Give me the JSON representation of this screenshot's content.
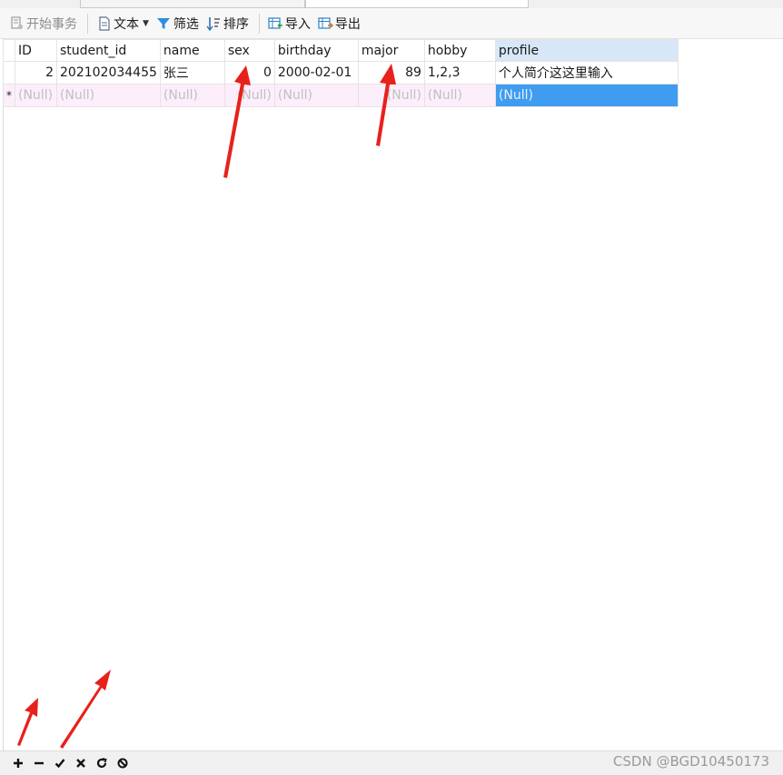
{
  "toolbar": {
    "begin_transaction": "开始事务",
    "text": "文本",
    "filter": "筛选",
    "sort": "排序",
    "import": "导入",
    "export": "导出"
  },
  "grid": {
    "columns": [
      "ID",
      "student_id",
      "name",
      "sex",
      "birthday",
      "major",
      "hobby",
      "profile"
    ],
    "rows": [
      [
        "2",
        "202102034455",
        "张三",
        "0",
        "2000-02-01",
        "89",
        "1,2,3",
        "个人简介这这里输入"
      ]
    ],
    "new_row_indicator": "*",
    "null_text": "(Null)"
  },
  "bottombar": {
    "icons": [
      "plus-icon",
      "minus-icon",
      "check-icon",
      "cross-icon",
      "refresh-icon",
      "stop-icon"
    ]
  },
  "watermark": "CSDN @BGD10450173",
  "colors": {
    "selected_cell": "#3f9cf0",
    "new_row_bg": "#fdeefb",
    "header_highlight": "#d7e7f7",
    "annotation_arrow": "#e8211b"
  }
}
